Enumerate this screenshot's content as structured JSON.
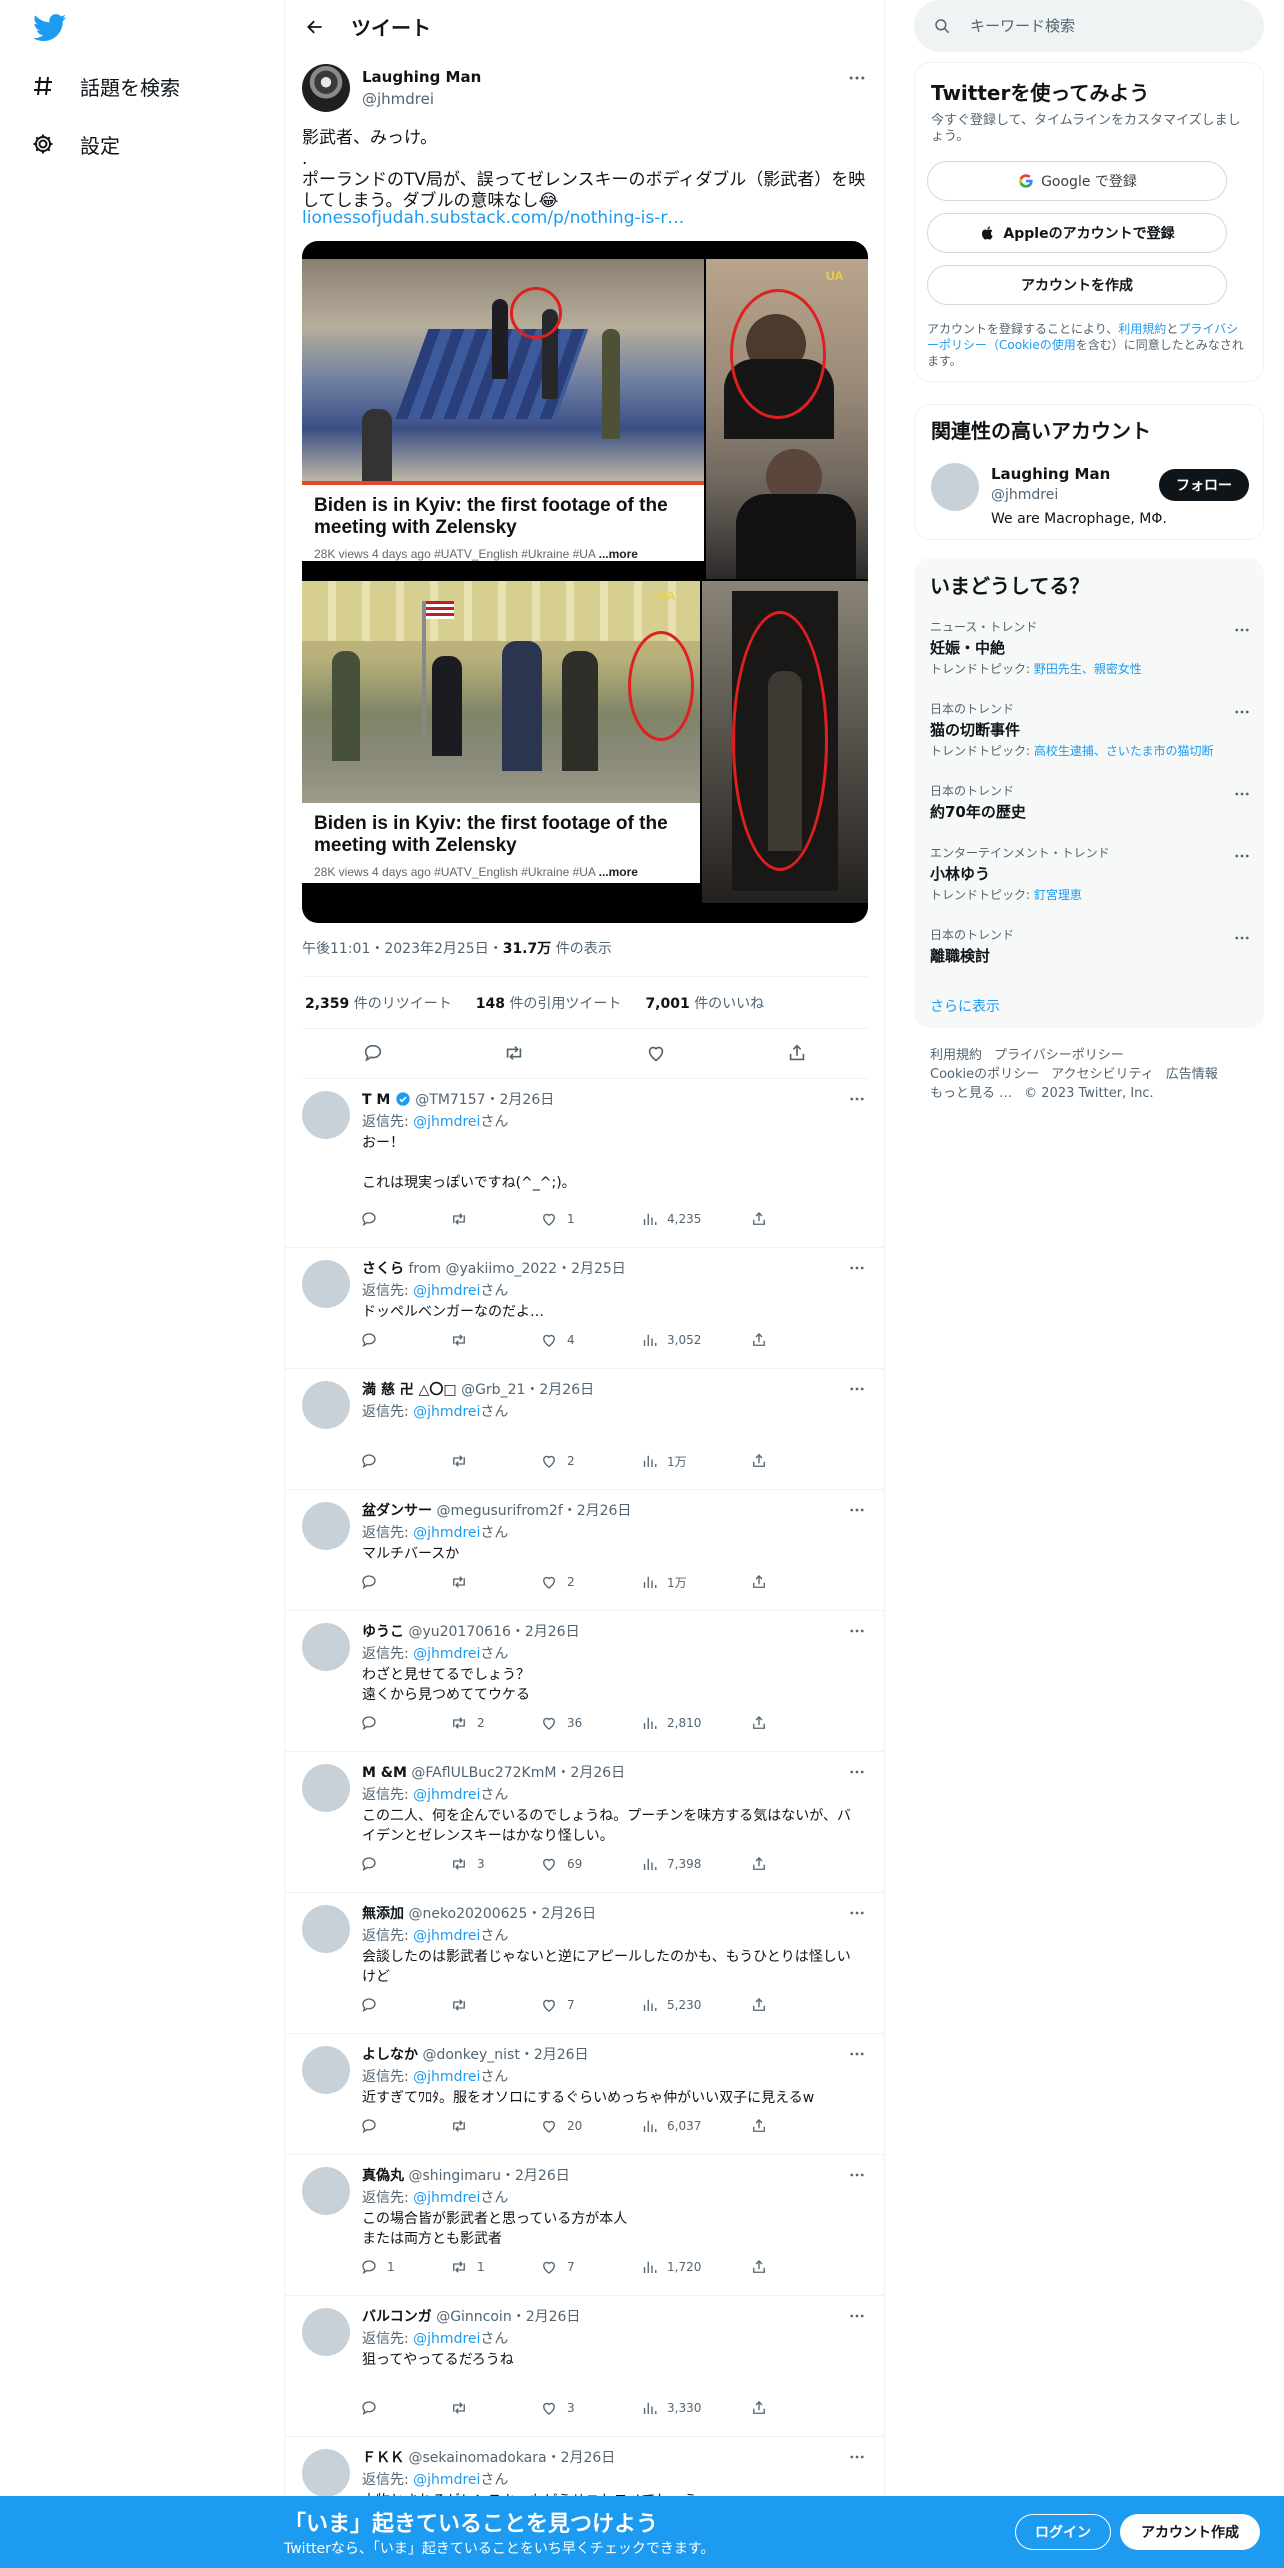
{
  "nav": {
    "explore_label": "話題を検索",
    "settings_label": "設定"
  },
  "header": {
    "title": "ツイート"
  },
  "tweet": {
    "author_name": "Laughing Man",
    "author_handle": "@jhmdrei",
    "text": "影武者、みっけ。\n.\nポーランドのTV局が、誤ってゼレンスキーのボディダブル（影武者）を映してしまう。ダブルの意味なし😂",
    "link": "lionessofjudah.substack.com/p/nothing-is-r…",
    "media": {
      "caption_title": "Biden is in Kyiv: the first footage of the meeting with Zelensky",
      "caption_meta": "28K views  4 days ago  #UATV_English  #Ukraine  #UA",
      "caption_more": "...more",
      "watermark": "UA"
    },
    "time": "午後11:01・2023年2月25日・",
    "views_count": "31.7万",
    "views_label": "件の表示",
    "retweets_count": "2,359",
    "retweets_label": "件のリツイート",
    "quotes_count": "148",
    "quotes_label": "件の引用ツイート",
    "likes_count": "7,001",
    "likes_label": "件のいいね"
  },
  "replies": [
    {
      "name": "T M",
      "verified": true,
      "handle": "@TM7157・2月26日",
      "to_prefix": "返信先: ",
      "to_handle": "@jhmdrei",
      "to_suffix": "さん",
      "text": "おー！\n\nこれは現実っぽいですね(^_^;)。",
      "replies": "",
      "retweets": "",
      "likes": "1",
      "views": "4,235"
    },
    {
      "name": "さくら",
      "verified": false,
      "handle": "from                                   @yakiimo_2022・2月25日",
      "to_prefix": "返信先: ",
      "to_handle": "@jhmdrei",
      "to_suffix": "さん",
      "text": "ドッペルベンガーなのだよ…",
      "replies": "",
      "retweets": "",
      "likes": "4",
      "views": "3,052"
    },
    {
      "name": "満 慈 卍 △〇□",
      "verified": false,
      "handle": "@Grb_21・2月26日",
      "to_prefix": "返信先: ",
      "to_handle": "@jhmdrei",
      "to_suffix": "さん",
      "text": "",
      "replies": "",
      "retweets": "",
      "likes": "2",
      "views": "1万"
    },
    {
      "name": "盆ダンサー",
      "verified": false,
      "handle": "@megusurifrom2f・2月26日",
      "to_prefix": "返信先: ",
      "to_handle": "@jhmdrei",
      "to_suffix": "さん",
      "text": "マルチバースか",
      "replies": "",
      "retweets": "",
      "likes": "2",
      "views": "1万"
    },
    {
      "name": "ゆうこ",
      "verified": false,
      "handle": "@yu20170616・2月26日",
      "to_prefix": "返信先: ",
      "to_handle": "@jhmdrei",
      "to_suffix": "さん",
      "text": "わざと見せてるでしょう？\n遠くから見つめててウケる",
      "replies": "",
      "retweets": "2",
      "likes": "36",
      "views": "2,810"
    },
    {
      "name": "M &M",
      "verified": false,
      "handle": "@FAflULBuc272KmM・2月26日",
      "to_prefix": "返信先: ",
      "to_handle": "@jhmdrei",
      "to_suffix": "さん",
      "text": "この二人、何を企んでいるのでしょうね。プーチンを味方する気はないが、バイデンとゼレンスキーはかなり怪しい。",
      "replies": "",
      "retweets": "3",
      "likes": "69",
      "views": "7,398"
    },
    {
      "name": "無添加",
      "verified": false,
      "handle": "@neko20200625・2月26日",
      "to_prefix": "返信先: ",
      "to_handle": "@jhmdrei",
      "to_suffix": "さん",
      "text": "会談したのは影武者じゃないと逆にアピールしたのかも、もうひとりは怪しいけど",
      "replies": "",
      "retweets": "",
      "likes": "7",
      "views": "5,230"
    },
    {
      "name": "よしなか",
      "verified": false,
      "handle": "@donkey_nist・2月26日",
      "to_prefix": "返信先: ",
      "to_handle": "@jhmdrei",
      "to_suffix": "さん",
      "text": "近すぎてﾜﾛﾀ。服をオソロにするぐらいめっちゃ仲がいい双子に見えるw",
      "replies": "",
      "retweets": "",
      "likes": "20",
      "views": "6,037"
    },
    {
      "name": "真偽丸",
      "verified": false,
      "handle": "@shingimaru・2月26日",
      "to_prefix": "返信先: ",
      "to_handle": "@jhmdrei",
      "to_suffix": "さん",
      "text": "この場合皆が影武者と思っている方が本人\nまたは両方とも影武者",
      "replies": "1",
      "retweets": "1",
      "likes": "7",
      "views": "1,720"
    },
    {
      "name": "バルコンガ",
      "verified": false,
      "handle": "@Ginncoin・2月26日",
      "to_prefix": "返信先: ",
      "to_handle": "@jhmdrei",
      "to_suffix": "さん",
      "text": "狙ってやってるだろうね",
      "replies": "",
      "retweets": "",
      "likes": "3",
      "views": "3,330"
    },
    {
      "name": "ＦＫＫ",
      "verified": false,
      "handle": "@sekainomadokara・2月26日",
      "to_prefix": "返信先: ",
      "to_handle": "@jhmdrei",
      "to_suffix": "さん",
      "text": "本物とされるゼレンスキーもどうせニセモノでしょう。",
      "replies": "",
      "retweets": "",
      "likes": "",
      "views": ""
    }
  ],
  "search": {
    "placeholder": "キーワード検索"
  },
  "signup_card": {
    "title": "Twitterを使ってみよう",
    "subtitle": "今すぐ登録して、タイムラインをカスタマイズしましょう。",
    "google_label": "Google で登録",
    "apple_label": "Appleのアカウントで登録",
    "create_label": "アカウントを作成",
    "terms_prefix": "アカウントを登録することにより、",
    "terms_link1": "利用規約",
    "terms_mid": "と",
    "terms_link2": "プライバシーポリシー（Cookieの使用",
    "terms_suffix": "を含む）に同意したとみなされます。"
  },
  "related": {
    "title": "関連性の高いアカウント",
    "name": "Laughing Man",
    "handle": "@jhmdrei",
    "bio": "We are Macrophage, MΦ.",
    "follow_label": "フォロー"
  },
  "trends": {
    "title": "いまどうしてる？",
    "items": [
      {
        "category": "ニュース・トレンド",
        "name": "妊娠・中絶",
        "topic_prefix": "トレンドトピック: ",
        "topic": "野田先生、親密女性"
      },
      {
        "category": "日本のトレンド",
        "name": "猫の切断事件",
        "topic_prefix": "トレンドトピック: ",
        "topic": "高校生逮捕、さいたま市の猫切断"
      },
      {
        "category": "日本のトレンド",
        "name": "約70年の歴史",
        "topic_prefix": "",
        "topic": ""
      },
      {
        "category": "エンターテインメント・トレンド",
        "name": "小林ゆう",
        "topic_prefix": "トレンドトピック: ",
        "topic": "釘宮理恵"
      },
      {
        "category": "日本のトレンド",
        "name": "離職検討",
        "topic_prefix": "",
        "topic": ""
      }
    ],
    "show_more": "さらに表示"
  },
  "footer": {
    "links": [
      "利用規約",
      "プライバシーポリシー",
      "Cookieのポリシー",
      "アクセシビリティ",
      "広告情報",
      "もっと見る …",
      "© 2023 Twitter, Inc."
    ]
  },
  "bottom_bar": {
    "title": "「いま」起きていることを見つけよう",
    "subtitle": "Twitterなら、「いま」起きていることをいち早くチェックできます。",
    "login_label": "ログイン",
    "signup_label": "アカウント作成"
  },
  "colors": {
    "accent": "#1d9bf0",
    "text": "#0f1419",
    "muted": "#536471"
  }
}
